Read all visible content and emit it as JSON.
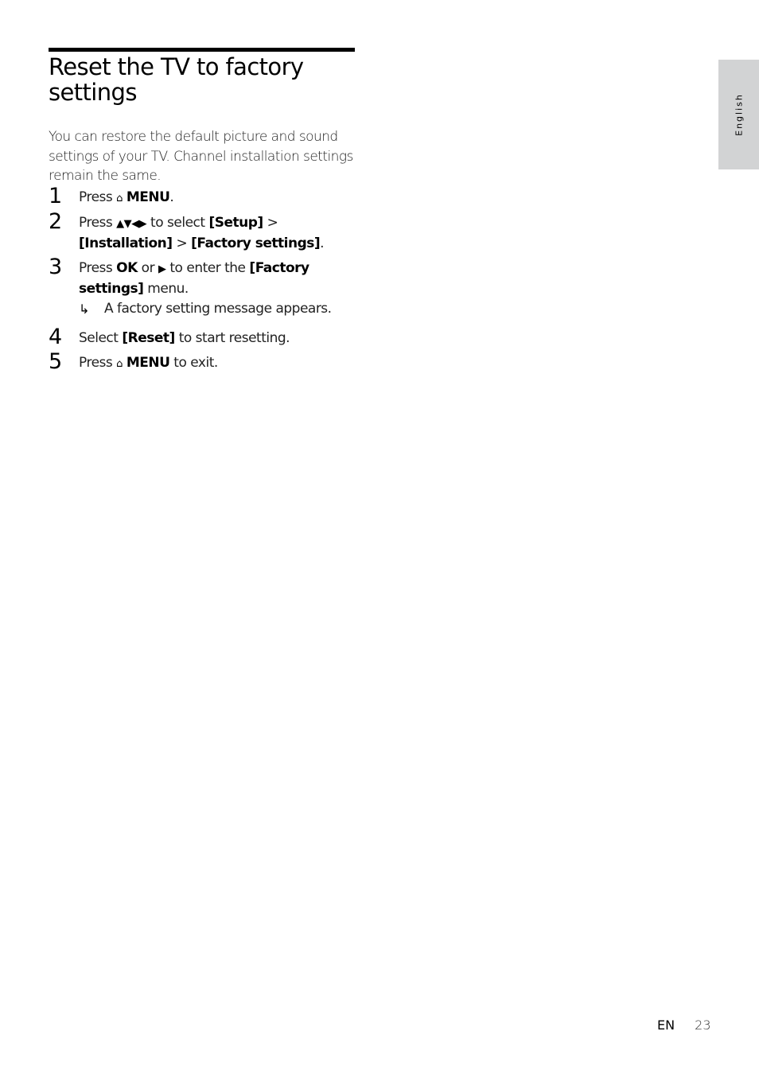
{
  "section": {
    "title": "Reset the TV to factory settings",
    "intro": "You can restore the default picture and sound settings of your TV. Channel installation settings remain the same."
  },
  "icons": {
    "home": "⌂",
    "home_symbol": "🏠",
    "arrows": "▲▼◀▶",
    "right": "▶",
    "result_arrow": "↳"
  },
  "steps": [
    {
      "number": "1",
      "parts": {
        "t1": "Press ",
        "icon": "home-icon",
        "k1": "MENU",
        "t2": "."
      }
    },
    {
      "number": "2",
      "parts": {
        "t1": "Press ",
        "icon": "navigation-arrows-icon",
        "t2": " to select ",
        "k1": "[Setup]",
        "t3": " > ",
        "k2": "[Installation]",
        "t4": " > ",
        "k3": "[Factory settings]",
        "t5": "."
      }
    },
    {
      "number": "3",
      "parts": {
        "t1": "Press ",
        "k1": "OK",
        "t2": " or ",
        "icon": "right-arrow-icon",
        "t3": " to enter the ",
        "k2": "[Factory settings]",
        "t4": " menu."
      },
      "result": "A factory setting message appears."
    },
    {
      "number": "4",
      "parts": {
        "t1": "Select ",
        "k1": "[Reset]",
        "t2": " to start resetting."
      }
    },
    {
      "number": "5",
      "parts": {
        "t1": "Press ",
        "icon": "home-icon",
        "k1": "MENU",
        "t2": " to exit."
      }
    }
  ],
  "side_tab": {
    "label": "English"
  },
  "footer": {
    "language_code": "EN",
    "page_number": "23"
  }
}
